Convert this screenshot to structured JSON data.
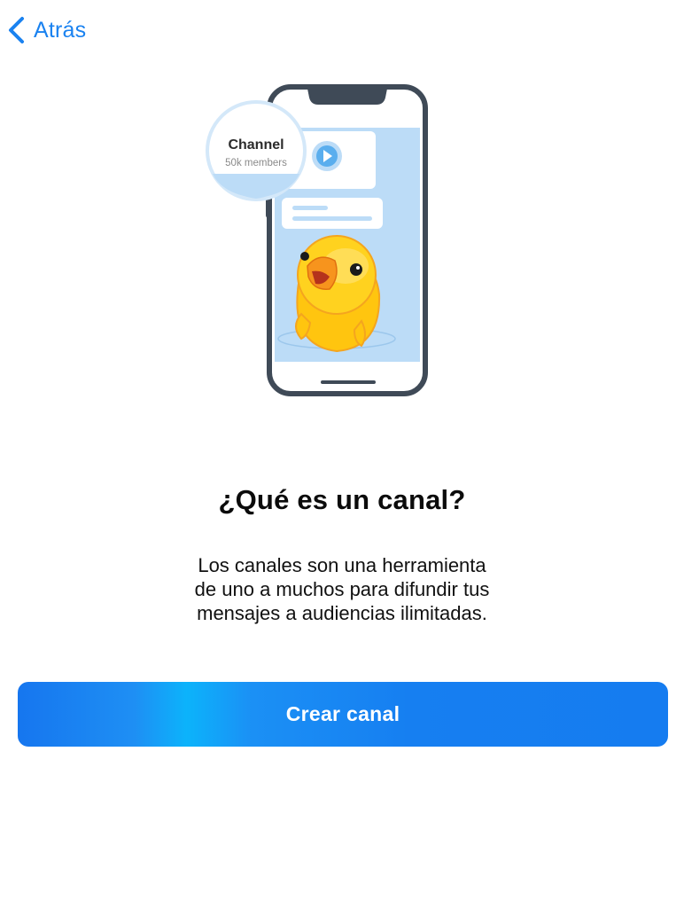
{
  "nav": {
    "back_label": "Atrás"
  },
  "illustration": {
    "channel_name": "Channel",
    "channel_members": "50k members"
  },
  "content": {
    "title": "¿Qué es un canal?",
    "description_lines": [
      "Los canales son una herramienta",
      "de uno a muchos para difundir tus",
      "mensajes a audiencias ilimitadas."
    ]
  },
  "actions": {
    "primary_label": "Crear canal"
  },
  "colors": {
    "accent": "#1a82f0",
    "button_gradient_highlight": "#0cb3fb",
    "phone_frame": "#3f4a57",
    "chat_background": "#bcdcf7",
    "duck_yellow": "#ffd21f",
    "duck_beak": "#f7941d"
  },
  "icons": {
    "back": "chevron-left-icon",
    "play": "play-icon"
  }
}
